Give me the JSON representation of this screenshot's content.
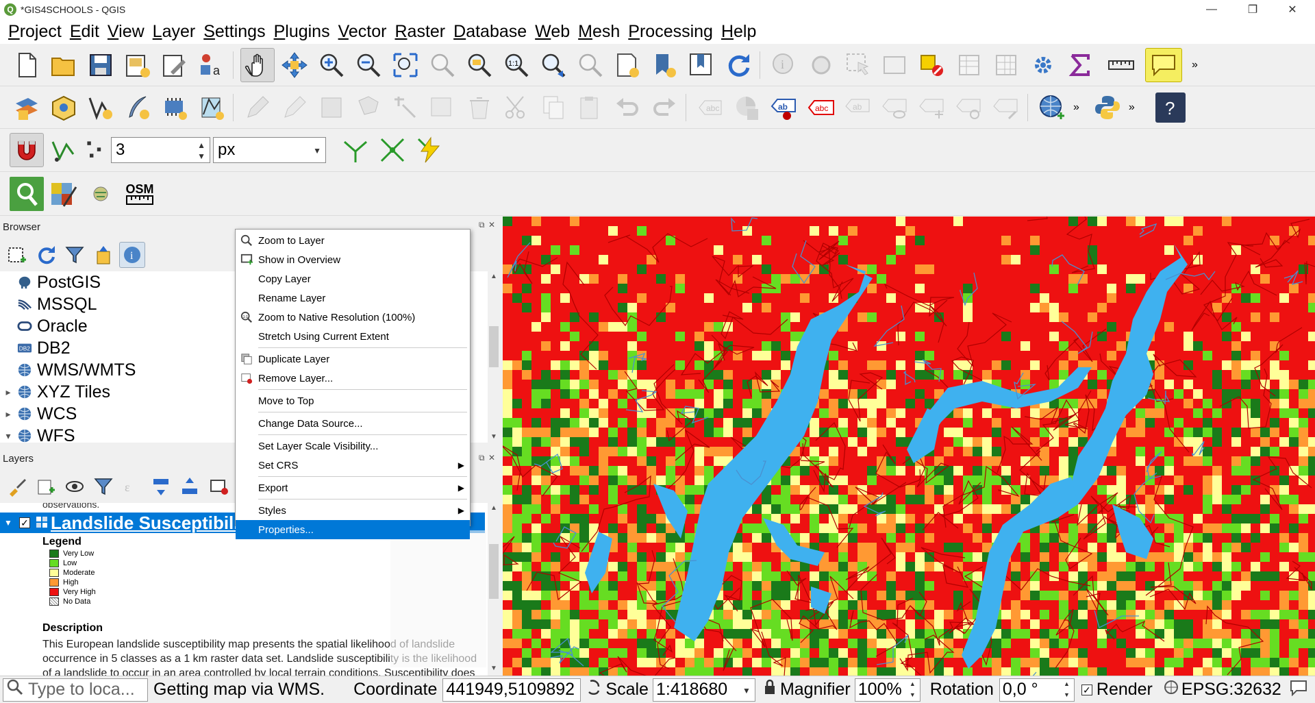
{
  "window": {
    "title": "*GIS4SCHOOLS - QGIS",
    "app_icon": "Q"
  },
  "menu": [
    "Project",
    "Edit",
    "View",
    "Layer",
    "Settings",
    "Plugins",
    "Vector",
    "Raster",
    "Database",
    "Web",
    "Mesh",
    "Processing",
    "Help"
  ],
  "snapping": {
    "tolerance": "3",
    "unit": "px"
  },
  "toolbar4": {
    "osm_label": "OSM"
  },
  "browser": {
    "title": "Browser",
    "items": [
      {
        "label": "PostGIS",
        "icon": "elephant-icon",
        "expandable": false
      },
      {
        "label": "MSSQL",
        "icon": "mssql-icon",
        "expandable": false
      },
      {
        "label": "Oracle",
        "icon": "oracle-icon",
        "expandable": false
      },
      {
        "label": "DB2",
        "icon": "db2-icon",
        "expandable": false
      },
      {
        "label": "WMS/WMTS",
        "icon": "globe-icon",
        "expandable": false
      },
      {
        "label": "XYZ Tiles",
        "icon": "globe-icon",
        "expandable": true
      },
      {
        "label": "WCS",
        "icon": "globe-icon",
        "expandable": true
      },
      {
        "label": "WFS",
        "icon": "globe-icon",
        "expandable": true
      }
    ]
  },
  "layers": {
    "title": "Layers",
    "partial_text": "observations.",
    "selected_layer": "Landslide Susceptibility",
    "legend_title": "Legend",
    "legend": [
      {
        "label": "Very Low",
        "color": "#1a7a1a"
      },
      {
        "label": "Low",
        "color": "#66dd22"
      },
      {
        "label": "Moderate",
        "color": "#ffff99"
      },
      {
        "label": "High",
        "color": "#ff9933"
      },
      {
        "label": "Very High",
        "color": "#ee1111"
      },
      {
        "label": "No Data",
        "color": "#ffffff"
      }
    ],
    "description_title": "Description",
    "description": "This European landslide susceptibility map presents the spatial likelihood of landslide occurrence in 5 classes as a 1 km raster data set. Landslide susceptibility is the likelihood of a landslide to occur in an area controlled by local terrain conditions. Susceptibility does"
  },
  "context_menu": [
    {
      "label": "Zoom to Layer",
      "icon": "zoom-icon"
    },
    {
      "label": "Show in Overview",
      "icon": "overview-icon"
    },
    {
      "label": "Copy Layer",
      "icon": ""
    },
    {
      "label": "Rename Layer",
      "icon": ""
    },
    {
      "label": "Zoom to Native Resolution (100%)",
      "icon": "zoom-native-icon"
    },
    {
      "label": "Stretch Using Current Extent",
      "icon": ""
    },
    {
      "sep": true
    },
    {
      "label": "Duplicate Layer",
      "icon": "duplicate-icon"
    },
    {
      "label": "Remove Layer...",
      "icon": "remove-icon"
    },
    {
      "sep": true
    },
    {
      "label": "Move to Top",
      "icon": ""
    },
    {
      "sep": true
    },
    {
      "label": "Change Data Source...",
      "icon": ""
    },
    {
      "sep": true
    },
    {
      "label": "Set Layer Scale Visibility...",
      "icon": ""
    },
    {
      "label": "Set CRS",
      "icon": "",
      "submenu": true
    },
    {
      "sep": true
    },
    {
      "label": "Export",
      "icon": "",
      "submenu": true
    },
    {
      "sep": true
    },
    {
      "label": "Styles",
      "icon": "",
      "submenu": true
    },
    {
      "label": "Properties...",
      "icon": "",
      "selected": true
    }
  ],
  "status": {
    "search_placeholder": "Type to loca...",
    "message": "Getting map via WMS.",
    "coordinate_label": "Coordinate",
    "coordinate": "441949,5109892",
    "scale_label": "Scale",
    "scale": "1:418680",
    "magnifier_label": "Magnifier",
    "magnifier": "100%",
    "rotation_label": "Rotation",
    "rotation": "0,0 °",
    "render_label": "Render",
    "crs": "EPSG:32632"
  },
  "colors": {
    "selection": "#0078d7",
    "water": "#3fb1ef"
  }
}
